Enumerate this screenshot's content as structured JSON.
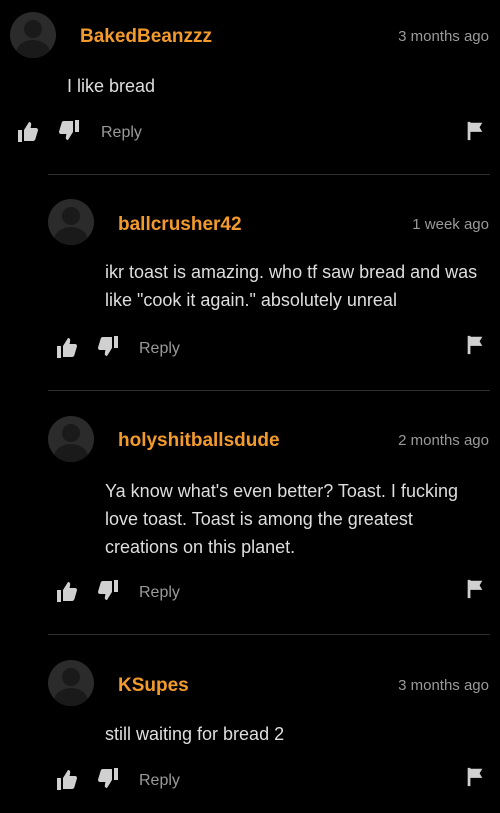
{
  "comments": [
    {
      "username": "BakedBeanzzz",
      "timestamp": "3 months ago",
      "body": "I like bread",
      "reply_label": "Reply"
    },
    {
      "username": "ballcrusher42",
      "timestamp": "1 week ago",
      "body": "ikr toast is amazing. who tf saw bread and was like \"cook it again.\" absolutely unreal",
      "reply_label": "Reply"
    },
    {
      "username": "holyshitballsdude",
      "timestamp": "2 months ago",
      "body": "Ya know what's even better? Toast. I fucking love toast. Toast is among the greatest creations on this planet.",
      "reply_label": "Reply"
    },
    {
      "username": "KSupes",
      "timestamp": "3 months ago",
      "body": "still waiting for bread 2",
      "reply_label": "Reply"
    }
  ],
  "colors": {
    "username": "#f39a2c",
    "background": "#000000",
    "muted_text": "#9a9a9a"
  },
  "icons": [
    "thumbs-up-icon",
    "thumbs-down-icon",
    "flag-icon"
  ]
}
